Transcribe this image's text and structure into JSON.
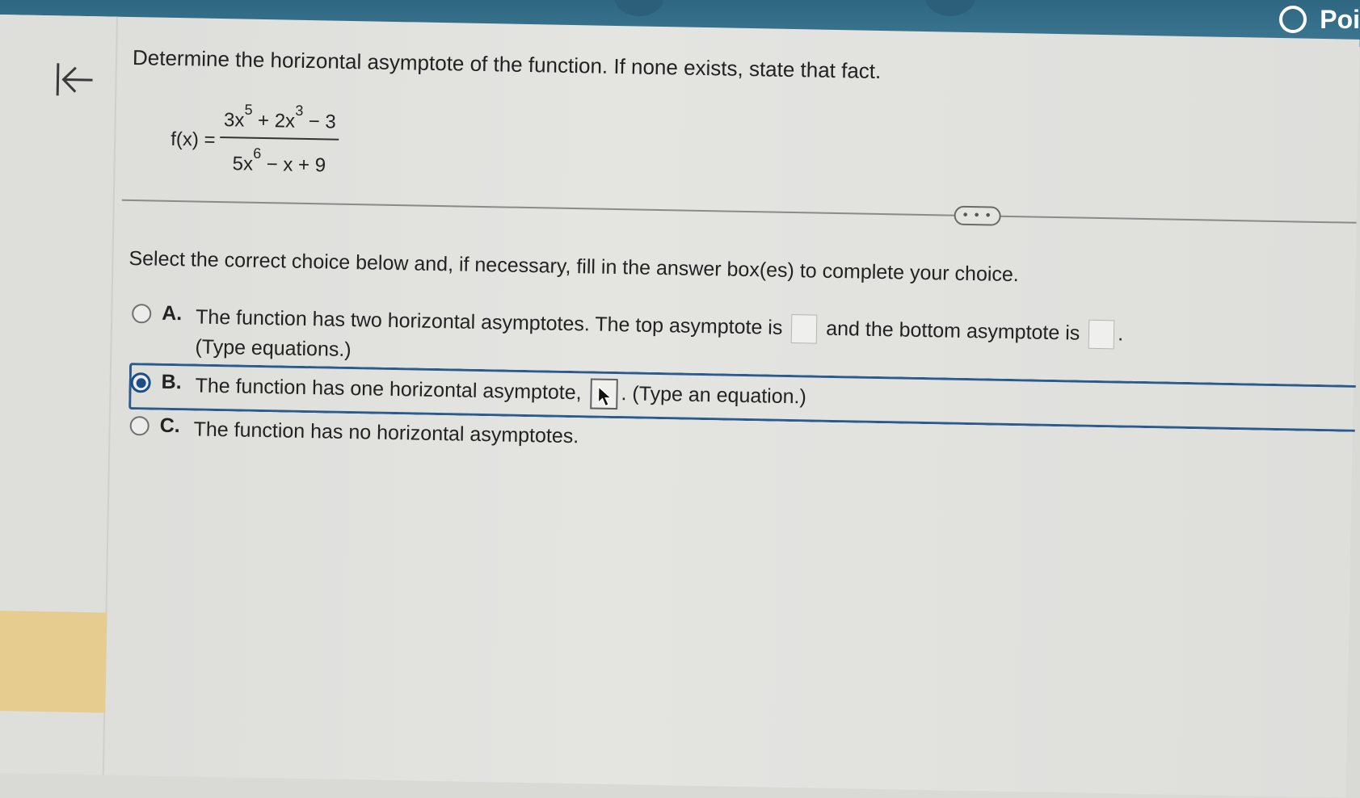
{
  "header": {
    "points_label": "Poi"
  },
  "question": {
    "prompt": "Determine the horizontal asymptote of the function. If none exists, state that fact.",
    "formula": {
      "lhs": "f(x) =",
      "num_term1": "3x",
      "num_exp1": "5",
      "num_term2": " + 2x",
      "num_exp2": "3",
      "num_term3": " − 3",
      "den_term1": "5x",
      "den_exp1": "6",
      "den_term2": " − x + 9"
    }
  },
  "more_button": "• • •",
  "instruction": "Select the correct choice below and, if necessary, fill in the answer box(es) to complete your choice.",
  "choices": [
    {
      "letter": "A.",
      "text_before": "The function has two horizontal asymptotes. The top asymptote is",
      "text_middle": "and the bottom asymptote is",
      "text_end": ".",
      "second_line": "(Type equations.)",
      "selected": false
    },
    {
      "letter": "B.",
      "text_before": "The function has one horizontal asymptote,",
      "text_after": ". (Type an equation.)",
      "selected": true
    },
    {
      "letter": "C.",
      "text": "The function has no horizontal asymptotes.",
      "selected": false
    }
  ],
  "colors": {
    "header_bar": "#3c7792",
    "selection_blue": "#1b4f87",
    "side_highlight": "#e6cc8e"
  }
}
